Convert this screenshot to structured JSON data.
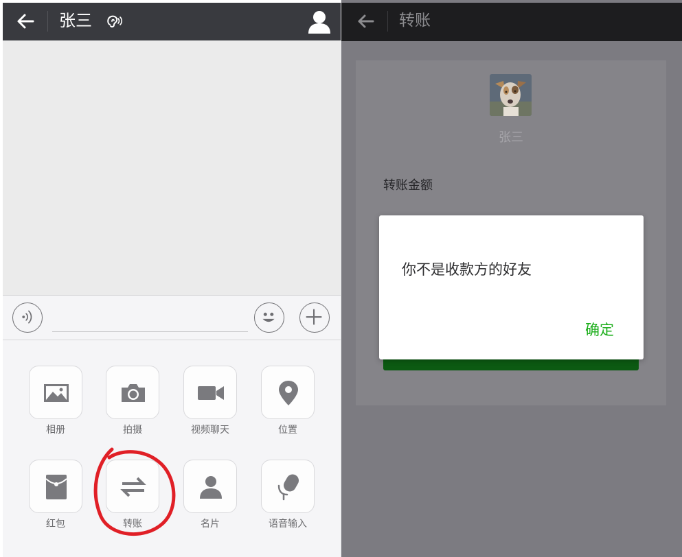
{
  "left": {
    "header": {
      "title": "张三"
    },
    "apps": [
      {
        "label": "相册",
        "icon": "photo-album-icon"
      },
      {
        "label": "拍摄",
        "icon": "camera-icon"
      },
      {
        "label": "视频聊天",
        "icon": "video-call-icon"
      },
      {
        "label": "位置",
        "icon": "location-pin-icon"
      },
      {
        "label": "红包",
        "icon": "red-packet-icon"
      },
      {
        "label": "转账",
        "icon": "transfer-icon"
      },
      {
        "label": "名片",
        "icon": "contact-card-icon"
      },
      {
        "label": "语音输入",
        "icon": "microphone-icon"
      }
    ],
    "highlight": {
      "color": "#e01f26",
      "target": "转账"
    }
  },
  "right": {
    "header": {
      "title": "转账"
    },
    "payee": {
      "name": "张三"
    },
    "amount_label": "转账金额",
    "dialog": {
      "message": "你不是收款方的好友",
      "confirm": "确定"
    }
  },
  "colors": {
    "header_dark": "#393a3f",
    "accent_green": "#1aad19",
    "overlay": "#7c7b81"
  }
}
